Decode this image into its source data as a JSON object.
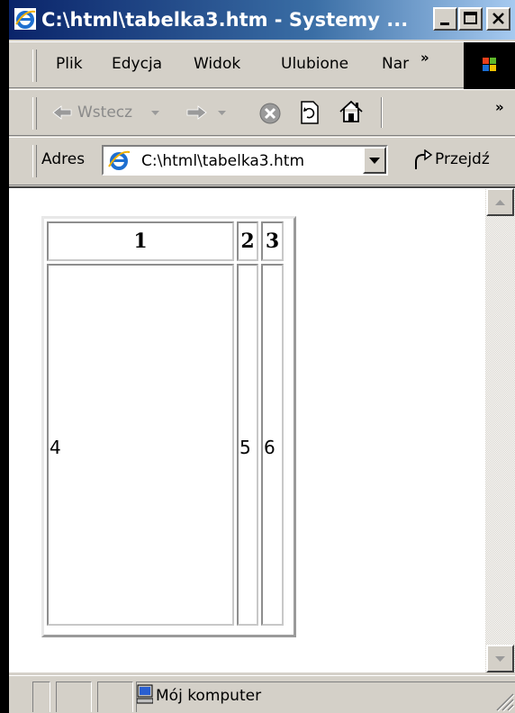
{
  "window": {
    "title": "C:\\html\\tabelka3.htm - Systemy ...",
    "colors": {
      "titlebar": "#0a246a",
      "chrome": "#d4d0c8"
    }
  },
  "menu": {
    "items": [
      "Plik",
      "Edycja",
      "Widok",
      "Ulubione",
      "Nar"
    ],
    "overflow": "»"
  },
  "toolbar": {
    "back_label": "Wstecz",
    "overflow": "»"
  },
  "address": {
    "label": "Adres",
    "value": "C:\\html\\tabelka3.htm",
    "go_label": "Przejdź"
  },
  "page": {
    "table": {
      "header": [
        "1",
        "2",
        "3"
      ],
      "body": [
        "4",
        "5",
        "6"
      ]
    }
  },
  "status": {
    "zone": "Mój komputer"
  }
}
